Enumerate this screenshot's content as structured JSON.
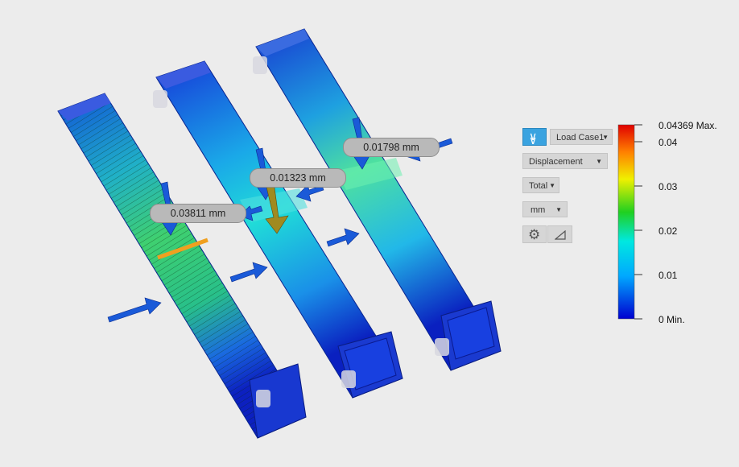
{
  "probes": [
    {
      "value": "0.03811 mm"
    },
    {
      "value": "0.01323 mm"
    },
    {
      "value": "0.01798 mm"
    }
  ],
  "panel": {
    "load_case": "Load Case1",
    "result_type": "Displacement",
    "component": "Total",
    "units": "mm",
    "settings_icon": "gear-icon",
    "probe_icon": "triangle-ruler-icon"
  },
  "legend": {
    "max_label": "0.04369 Max.",
    "ticks": [
      "0.04",
      "0.03",
      "0.02",
      "0.01"
    ],
    "min_label": "0 Min."
  },
  "colors": {
    "accent": "#3aa3e0",
    "background": "#ececec"
  }
}
